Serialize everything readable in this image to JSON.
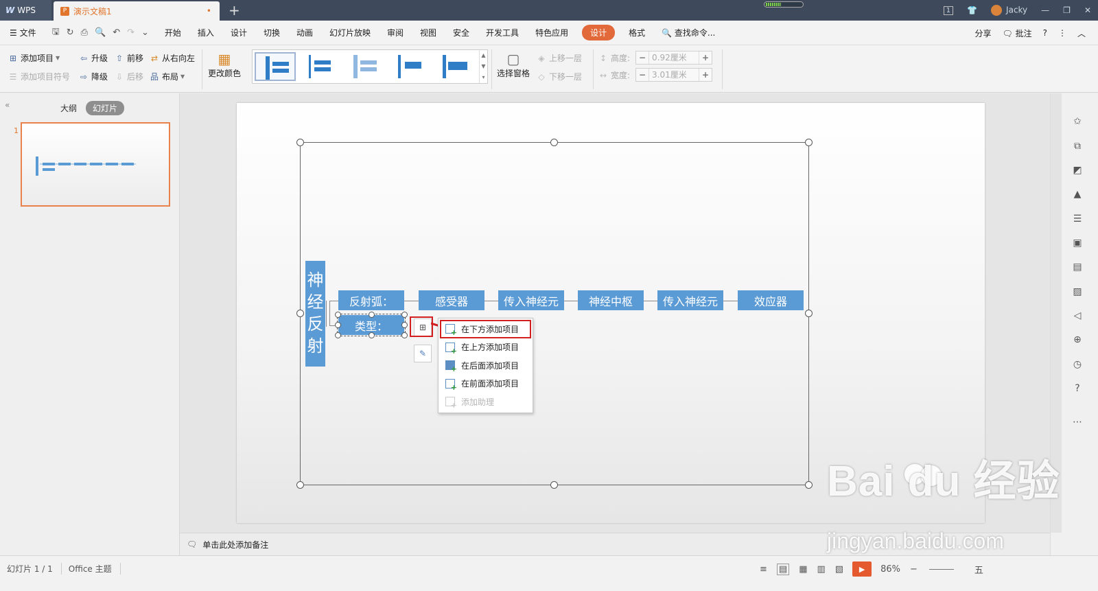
{
  "titlebar": {
    "app_name": "WPS",
    "doc_tab": "演示文稿1",
    "doc_tab_icon": "P",
    "modified_dot": "•",
    "new_tab": "+",
    "page_counter": "1",
    "user_name": "Jacky"
  },
  "menubar": {
    "file": "文件",
    "items": [
      "开始",
      "插入",
      "设计",
      "切换",
      "动画",
      "幻灯片放映",
      "审阅",
      "视图",
      "安全",
      "开发工具",
      "特色应用"
    ],
    "active_tab": "设计",
    "format_tab": "格式",
    "search": "查找命令...",
    "share": "分享",
    "comment": "批注",
    "help": "?",
    "more": "⋮",
    "collapse": "︿"
  },
  "ribbon": {
    "add_item": "添加项目",
    "add_bullet": "添加项目符号",
    "promote": "升级",
    "demote": "降级",
    "move_forward": "前移",
    "move_backward": "后移",
    "right_to_left": "从右向左",
    "layout": "布局",
    "change_colors": "更改颜色",
    "selection_pane": "选择窗格",
    "bring_forward": "上移一层",
    "send_backward": "下移一层",
    "height_label": "高度:",
    "height_value": "0.92厘米",
    "width_label": "宽度:",
    "width_value": "3.01厘米",
    "minus": "−",
    "plus": "+"
  },
  "leftpanel": {
    "outline_tab": "大纲",
    "slides_tab": "幻灯片",
    "slide_number": "1",
    "collapse": "«"
  },
  "slide": {
    "vertical_title": "神经反射",
    "row1": [
      "反射弧：",
      "感受器",
      "传入神经元",
      "神经中枢",
      "传入神经元",
      "效应器"
    ],
    "row2": "类型："
  },
  "context_menu": {
    "items": [
      {
        "label": "在下方添加项目",
        "enabled": true,
        "highlighted": true
      },
      {
        "label": "在上方添加项目",
        "enabled": true,
        "highlighted": false
      },
      {
        "label": "在后面添加项目",
        "enabled": true,
        "highlighted": false
      },
      {
        "label": "在前面添加项目",
        "enabled": true,
        "highlighted": false
      },
      {
        "label": "添加助理",
        "enabled": false,
        "highlighted": false
      }
    ]
  },
  "notes": {
    "placeholder": "单击此处添加备注"
  },
  "status": {
    "slide_count": "幻灯片 1 / 1",
    "theme": "Office 主题",
    "zoom": "86%",
    "ime": "五"
  },
  "watermark": {
    "main": "Bai du 经验",
    "sub": "jingyan.baidu.com"
  },
  "colors": {
    "accent": "#e26a3a",
    "smartart_blue": "#5b9bd5",
    "highlight_red": "#d21f1f",
    "titlebar_bg": "#3e4a5c"
  }
}
